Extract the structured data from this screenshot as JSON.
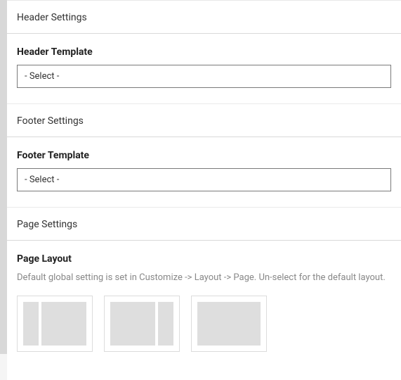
{
  "sections": {
    "header": {
      "title": "Header Settings",
      "field_label": "Header Template",
      "select_value": "- Select -"
    },
    "footer": {
      "title": "Footer Settings",
      "field_label": "Footer Template",
      "select_value": "- Select -"
    },
    "page": {
      "title": "Page Settings",
      "field_label": "Page Layout",
      "help_text": "Default global setting is set in Customize -> Layout -> Page. Un-select for the default layout.",
      "layout_options": [
        {
          "id": "sidebar-left"
        },
        {
          "id": "sidebar-right"
        },
        {
          "id": "full-width"
        }
      ]
    }
  }
}
